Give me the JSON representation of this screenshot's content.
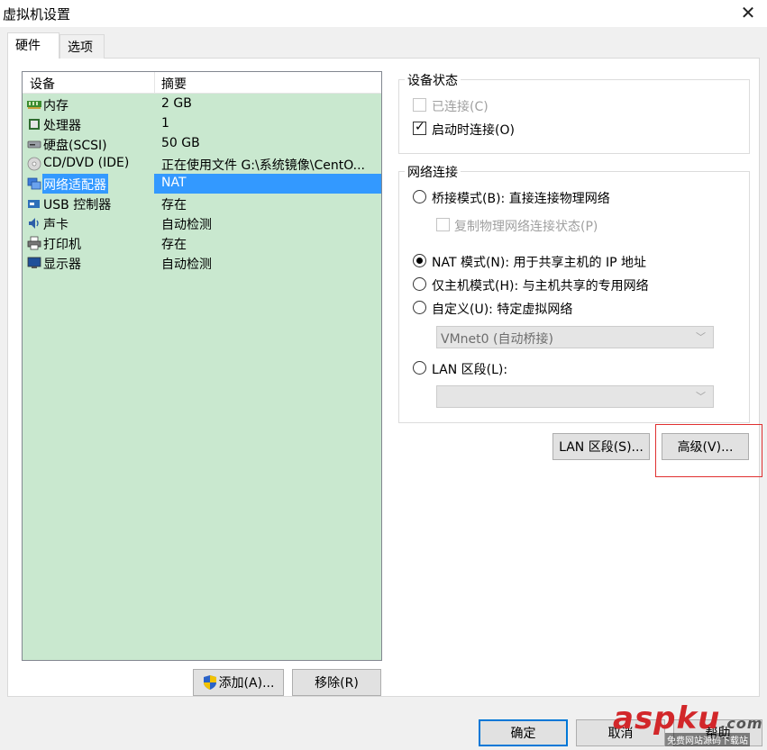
{
  "window": {
    "title": "虚拟机设置",
    "close_glyph": "✕"
  },
  "tabs": [
    {
      "label": "硬件",
      "active": true
    },
    {
      "label": "选项",
      "active": false
    }
  ],
  "device_list": {
    "columns": [
      "设备",
      "摘要"
    ],
    "rows": [
      {
        "icon": "memory-icon",
        "name": "内存",
        "summary": "2 GB",
        "selected": false
      },
      {
        "icon": "processor-icon",
        "name": "处理器",
        "summary": "1",
        "selected": false
      },
      {
        "icon": "harddisk-icon",
        "name": "硬盘(SCSI)",
        "summary": "50 GB",
        "selected": false
      },
      {
        "icon": "cdrom-icon",
        "name": "CD/DVD (IDE)",
        "summary": "正在使用文件 G:\\系统镜像\\CentO...",
        "selected": false
      },
      {
        "icon": "network-adapter-icon",
        "name": "网络适配器",
        "summary": "NAT",
        "selected": true
      },
      {
        "icon": "usb-icon",
        "name": "USB 控制器",
        "summary": "存在",
        "selected": false
      },
      {
        "icon": "sound-icon",
        "name": "声卡",
        "summary": "自动检测",
        "selected": false
      },
      {
        "icon": "printer-icon",
        "name": "打印机",
        "summary": "存在",
        "selected": false
      },
      {
        "icon": "display-icon",
        "name": "显示器",
        "summary": "自动检测",
        "selected": false
      }
    ]
  },
  "buttons": {
    "add": "添加(A)...",
    "remove": "移除(R)",
    "lan_segments": "LAN 区段(S)...",
    "advanced": "高级(V)...",
    "ok": "确定",
    "cancel": "取消",
    "help": "帮助"
  },
  "device_status": {
    "title": "设备状态",
    "connected": {
      "label": "已连接(C)",
      "checked": false,
      "enabled": false
    },
    "connect_at_power_on": {
      "label": "启动时连接(O)",
      "checked": true,
      "enabled": true
    }
  },
  "network_connection": {
    "title": "网络连接",
    "bridged": {
      "label": "桥接模式(B): 直接连接物理网络",
      "selected": false
    },
    "replicate": {
      "label": "复制物理网络连接状态(P)",
      "checked": false,
      "enabled": false
    },
    "nat": {
      "label": "NAT 模式(N): 用于共享主机的 IP 地址",
      "selected": true
    },
    "host_only": {
      "label": "仅主机模式(H): 与主机共享的专用网络",
      "selected": false
    },
    "custom": {
      "label": "自定义(U): 特定虚拟网络",
      "selected": false
    },
    "custom_select_value": "VMnet0 (自动桥接)",
    "lan_segment": {
      "label": "LAN 区段(L):",
      "selected": false
    },
    "lan_select_value": ""
  },
  "watermark": {
    "brand": "aspku",
    "suffix": ".com",
    "tagline": "免费网站源码下载站"
  },
  "colors": {
    "list_background": "#c9e8cf",
    "selection": "#3399ff",
    "highlight_border": "#e03030"
  }
}
